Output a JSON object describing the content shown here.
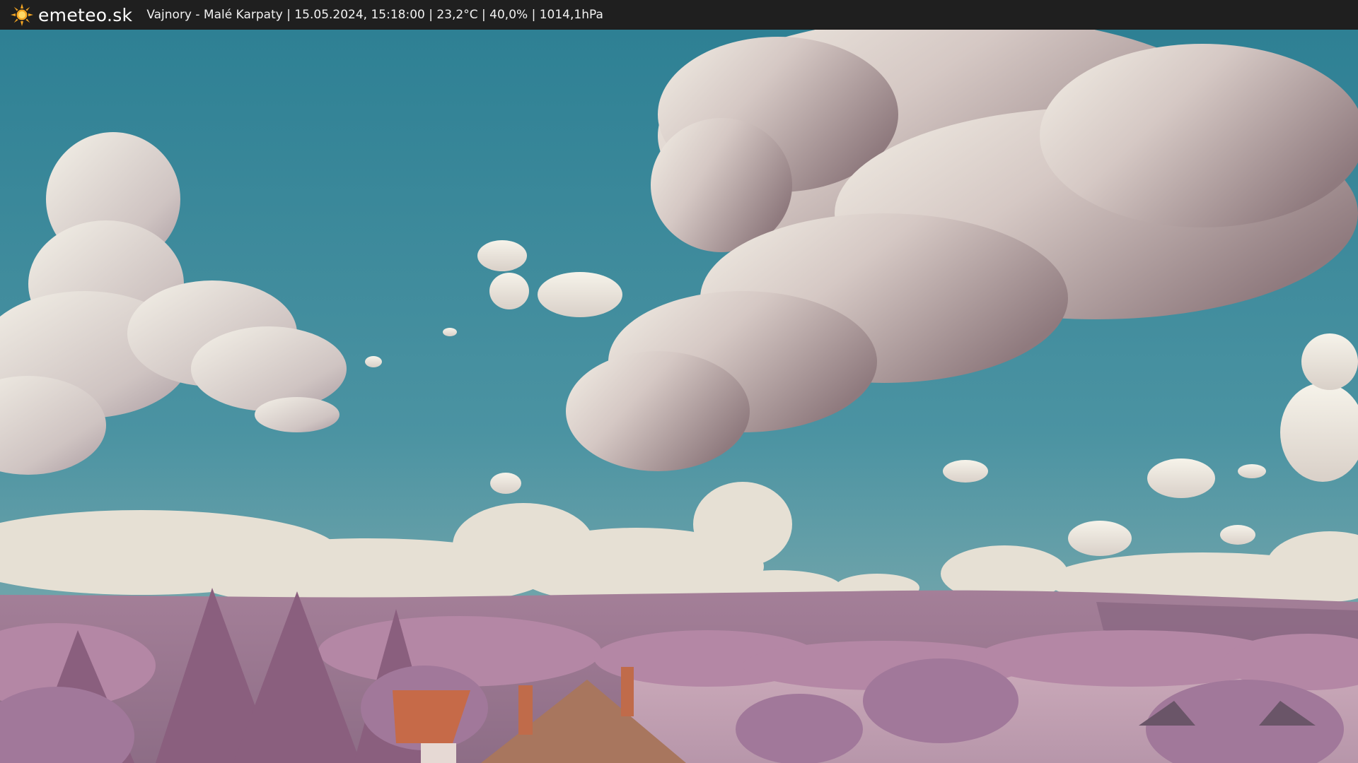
{
  "header": {
    "brand": "emeteo.sk",
    "brand_icon": "sun-icon",
    "location": "Vajnory - Malé Karpaty",
    "datetime": "15.05.2024, 15:18:00",
    "temperature": "23,2°C",
    "humidity": "40,0%",
    "pressure": "1014,1hPa",
    "separator": " | "
  },
  "colors": {
    "bar_background": "#1f1f1f",
    "sun": "#f5a623",
    "sky_top": "#2f8296",
    "sky_bottom": "#6aa3ad",
    "cloud": "#efeadf",
    "cloud_shadow": "#a8928f",
    "hills": "#9c7a94",
    "foliage": "#b78aa6",
    "roof": "#b06a45"
  }
}
